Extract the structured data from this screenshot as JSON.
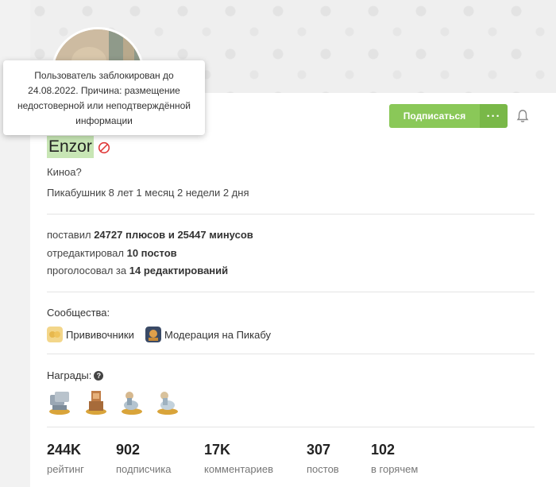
{
  "tooltip": {
    "text": "Пользователь заблокирован до 24.08.2022. Причина: размещение недостоверной или неподтверждённой информации"
  },
  "profile": {
    "username": "Enzor",
    "bio": "Киноа?",
    "tenure": "Пикабушник 8 лет 1 месяц 2 недели 2 дня"
  },
  "actions": {
    "subscribe_label": "Подписаться",
    "more_label": "···"
  },
  "activity": {
    "line1_prefix": "поставил",
    "pluses": "24727",
    "pluses_word": "плюсов",
    "and": "и",
    "minuses": "25447",
    "minuses_word": "минусов",
    "line2_prefix": "отредактировал",
    "edited": "10 постов",
    "line3_prefix": "проголосовал за",
    "voted": "14",
    "voted_word": "редактирований"
  },
  "communities": {
    "title": "Сообщества:",
    "items": [
      {
        "label": "Прививочники"
      },
      {
        "label": "Модерация на Пикабу"
      }
    ]
  },
  "awards": {
    "title": "Награды:",
    "help_glyph": "?"
  },
  "stats": [
    {
      "value": "244K",
      "label": "рейтинг"
    },
    {
      "value": "902",
      "label": "подписчика"
    },
    {
      "value": "17K",
      "label": "комментариев"
    },
    {
      "value": "307",
      "label": "постов"
    },
    {
      "value": "102",
      "label": "в горячем"
    }
  ],
  "colors": {
    "accent_green": "#8ac858",
    "plus_green": "#6fa84a",
    "minus_red": "#d33a2c",
    "ban_red": "#e03b3b"
  }
}
